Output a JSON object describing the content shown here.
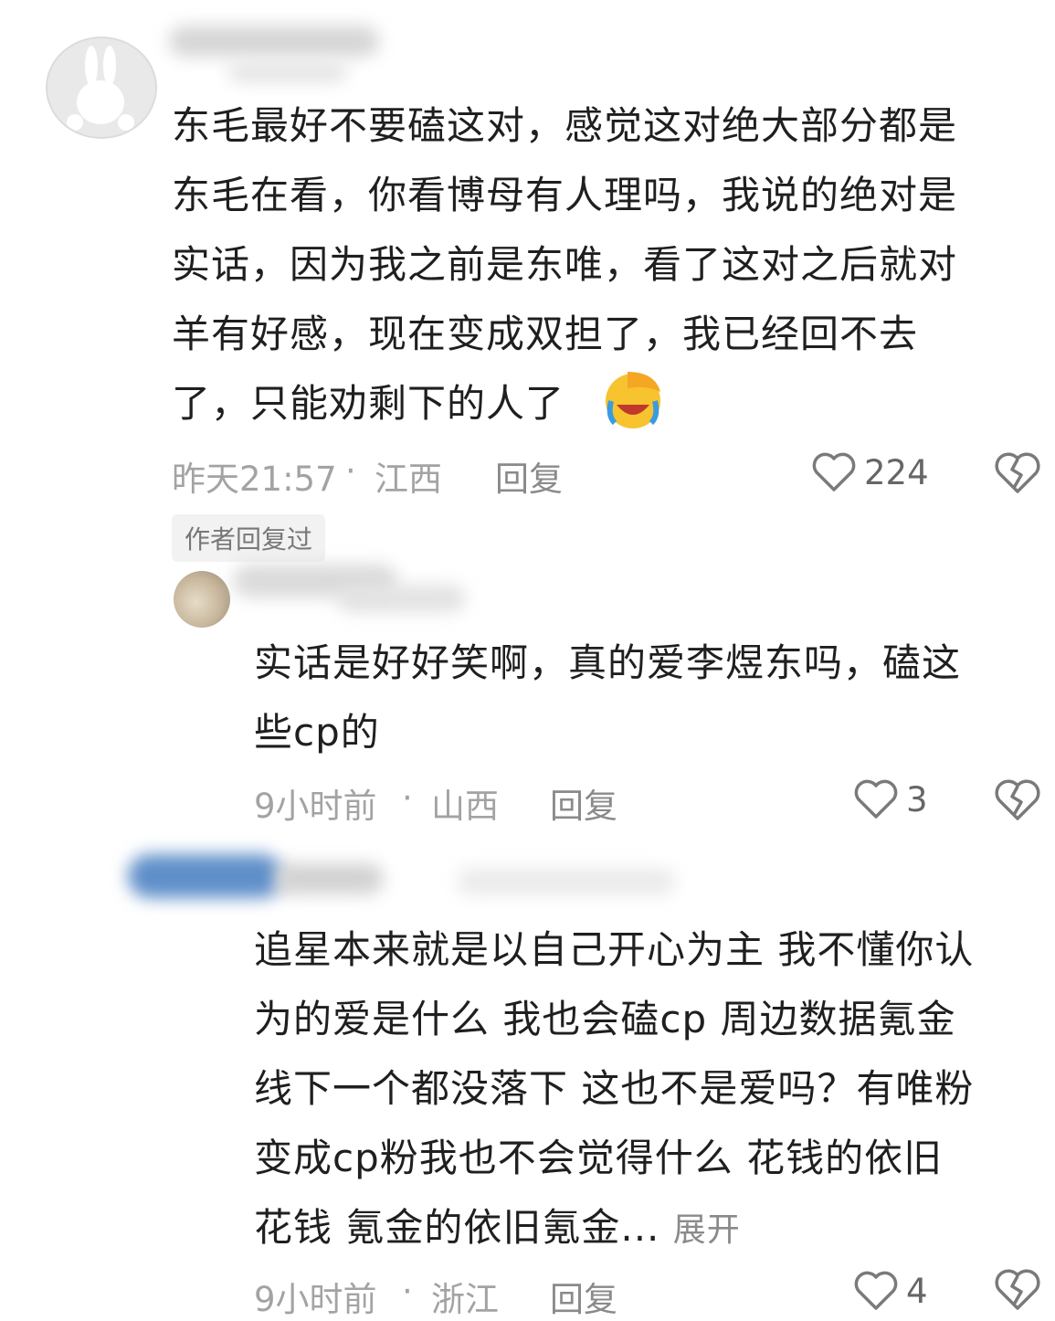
{
  "comments": [
    {
      "text": "东毛最好不要磕这对，感觉这对绝大部分都是\n东毛在看，你看博母有人理吗，我说的绝对是\n实话，因为我之前是东唯，看了这对之后就对\n羊有好感，现在变成双担了，我已经回不去\n了，只能劝剩下的人了",
      "emoji": "facepalm-cry-emoji",
      "time": "昨天21:57",
      "separator": "·",
      "location": "江西",
      "reply_label": "回复",
      "likes": "224",
      "tag": "作者回复过"
    },
    {
      "text": "实话是好好笑啊，真的爱李煜东吗，磕这\n些cp的",
      "time": "9小时前",
      "separator": "·",
      "location": "山西",
      "reply_label": "回复",
      "likes": "3"
    },
    {
      "text": "追星本来就是以自己开心为主 我不懂你认\n为的爱是什么 我也会磕cp 周边数据氪金\n线下一个都没落下 这也不是爱吗？有唯粉\n变成cp粉我也不会觉得什么 花钱的依旧\n花钱 氪金的依旧氪金...",
      "expand_label": "展开",
      "time": "9小时前",
      "separator": "·",
      "location": "浙江",
      "reply_label": "回复",
      "likes": "4"
    }
  ],
  "colors": {
    "text": "#1f1f1f",
    "meta": "#a3a3a3",
    "icon": "#7a7a7a",
    "tag_bg": "#f2f2f2"
  }
}
